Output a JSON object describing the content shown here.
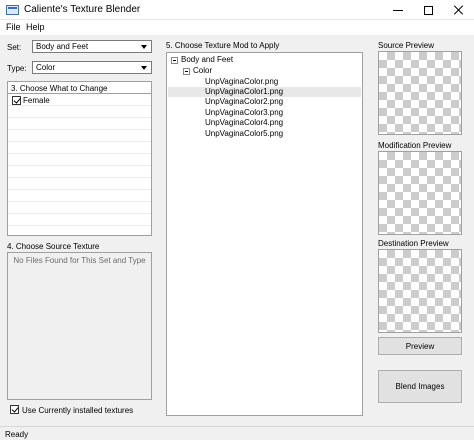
{
  "window": {
    "title": "Caliente's Texture Blender",
    "minimize_glyph": "",
    "maximize_glyph": "",
    "close_glyph": ""
  },
  "menu": {
    "file": "File",
    "help": "Help"
  },
  "filters": {
    "set_label": "Set:",
    "set_value": "Body and Feet",
    "type_label": "Type:",
    "type_value": "Color"
  },
  "change_panel": {
    "title": "3. Choose What to Change",
    "items": [
      {
        "label": "Female",
        "checked": true
      }
    ]
  },
  "source_panel": {
    "title": "4. Choose Source Texture",
    "empty_text": "No Files Found for This Set and Type",
    "use_installed_label": "Use Currently installed textures",
    "use_installed_checked": true
  },
  "tree_panel": {
    "title": "5. Choose Texture Mod to Apply",
    "root": "Body and Feet",
    "child": "Color",
    "files": [
      "UnpVaginaColor.png",
      "UnpVaginaColor1.png",
      "UnpVaginaColor2.png",
      "UnpVaginaColor3.png",
      "UnpVaginaColor4.png",
      "UnpVaginaColor5.png"
    ],
    "selected_index": 1
  },
  "previews": {
    "source_title": "Source Preview",
    "modification_title": "Modification Preview",
    "destination_title": "Destination Preview",
    "preview_button": "Preview",
    "blend_button": "Blend Images"
  },
  "status": {
    "text": "Ready"
  }
}
